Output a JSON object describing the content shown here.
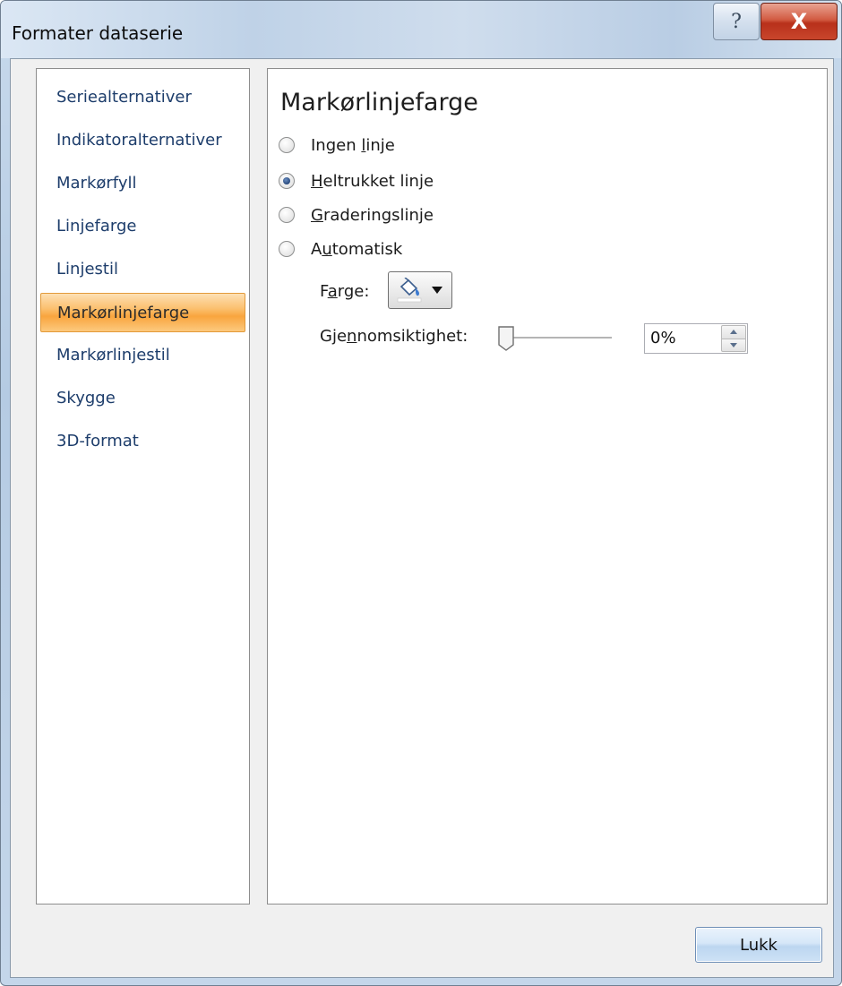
{
  "window": {
    "title": "Formater dataserie",
    "help_glyph": "?",
    "close_glyph": "X"
  },
  "sidebar": {
    "selected_index": 5,
    "items": [
      {
        "label": "Seriealternativer"
      },
      {
        "label": "Indikatoralternativer"
      },
      {
        "label": "Markørfyll"
      },
      {
        "label": "Linjefarge"
      },
      {
        "label": "Linjestil"
      },
      {
        "label": "Markørlinjefarge"
      },
      {
        "label": "Markørlinjestil"
      },
      {
        "label": "Skygge"
      },
      {
        "label": "3D-format"
      }
    ]
  },
  "content": {
    "section_title": "Markørlinjefarge",
    "options": [
      {
        "pre": "Ingen ",
        "mn": "l",
        "post": "inje",
        "selected": false
      },
      {
        "pre": "",
        "mn": "H",
        "post": "eltrukket linje",
        "selected": true
      },
      {
        "pre": "",
        "mn": "G",
        "post": "raderingslinje",
        "selected": false
      },
      {
        "pre": "A",
        "mn": "u",
        "post": "tomatisk",
        "selected": false
      }
    ],
    "color": {
      "label_pre": "F",
      "label_mn": "a",
      "label_post": "rge:",
      "icon": "paint-bucket-icon"
    },
    "transparency": {
      "label_pre": "Gje",
      "label_mn": "n",
      "label_post": "nomsiktighet:",
      "value": "0%",
      "slider_fraction": 0.0
    }
  },
  "footer": {
    "close_label": "Lukk"
  },
  "colors": {
    "selected_nav_accent": "#f9a53e",
    "nav_text": "#1d3d6b",
    "close_button_red": "#c9462c"
  }
}
